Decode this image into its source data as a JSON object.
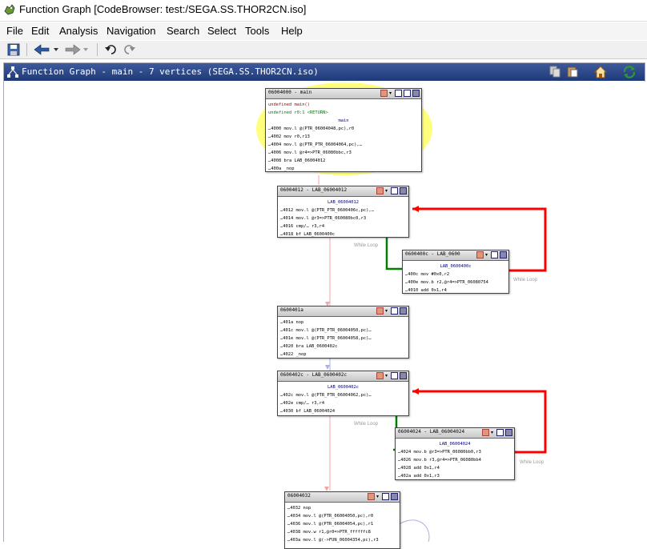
{
  "window": {
    "title": "Function Graph [CodeBrowser: test:/SEGA.SS.THOR2CN.iso]"
  },
  "menu": [
    "File",
    "Edit",
    "Analysis",
    "Navigation",
    "Search",
    "Select",
    "Tools",
    "Help"
  ],
  "toolbar": {
    "icons": [
      "save-icon",
      "back-icon",
      "forward-icon",
      "undo-icon",
      "redo-icon"
    ]
  },
  "panel": {
    "title": "Function Graph - main - 7 vertices   (SEGA.SS.THOR2CN.iso)",
    "icons": [
      "copy-icon",
      "paste-icon",
      "home-icon",
      "refresh-icon"
    ]
  },
  "colors": {
    "edge_fallthrough": "#ff0000",
    "edge_conditional": "#008000",
    "edge_unconditional": "#f4a6a6",
    "highlight": "#ffff66"
  },
  "nodes": [
    {
      "header": "06004000 - main",
      "lines": [
        "undefined main()",
        "     undefined        r0:1           <RETURN>",
        "                  main",
        "…4000 mov.l @(PTR_06004048,pc),r0",
        "…4002 mov   r0,r13",
        "…4004 mov.l @(PTR_PTR_06004064,pc),…",
        "…4006 mov.l @r4=>PTR_06080bbc,r3",
        "…4008 bra   LAB_06004012",
        "…400a _nop"
      ]
    },
    {
      "header": "06004012 - LAB_06004012",
      "lines": [
        "LAB_06004012",
        "…4012 mov.l @(PTR_PTR_0600406c,pc),…",
        "…4014 mov.l @r3=>PTR_060080bc0,r3",
        "…4016 cmp/… r3,r4",
        "…4018 bf    LAB_0600400c"
      ]
    },
    {
      "header": "0600400c - LAB_0600",
      "lines": [
        "LAB_0600400c",
        "…400c mov   #0x0,r2",
        "…400e mov.b r2,@r4=>PTR_06080754",
        "…4010 add   0x1,r4"
      ]
    },
    {
      "header": "0600401a",
      "lines": [
        "…401a nop",
        "…401c mov.l @(PTR_PTR_06004050,pc)…",
        "…401e mov.l @(PTR_PTR_06004058,pc)…",
        "…4020 bra   LAB_0600402c",
        "…4022 _nop"
      ]
    },
    {
      "header": "0600402c - LAB_0600402c",
      "lines": [
        "LAB_0600402c",
        "…402c mov.l @(PTR_PTR_06004062,pc)…",
        "…402e cmp/… r3,r4",
        "…4030 bf    LAB_06004024"
      ]
    },
    {
      "header": "06004024 - LAB_06004024",
      "lines": [
        "LAB_06004024",
        "…4024 mov.b @r3=>PTR_06080bb0,r3",
        "…4026 mov.b r3,@r4=>PTR_06080bb4",
        "…4028 add   0x1,r4",
        "…402a add   0x1,r3"
      ]
    },
    {
      "header": "06004032",
      "lines": [
        "…4032 nop",
        "…4034 mov.l @(PTR_06004050,pc),r0",
        "…4036 mov.l @(PTR_06004054,pc),r1",
        "…4038 mov.w r1,@r0=>PTR_ffffffc8",
        "…403a mov.l @(->FUN_06004354,pc),r3"
      ]
    }
  ],
  "edge_labels": [
    "While Loop",
    "While Loop",
    "While Loop",
    "While Loop"
  ]
}
